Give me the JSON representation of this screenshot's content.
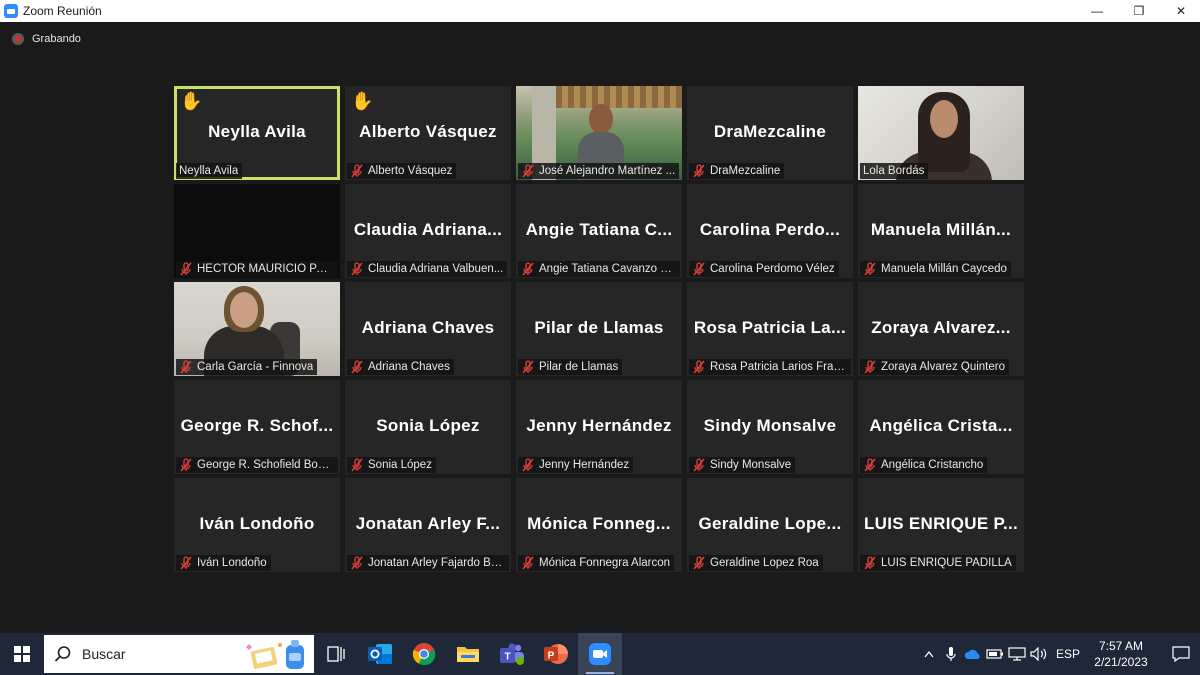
{
  "window": {
    "title": "Zoom Reunión",
    "minimize_label": "—",
    "maximize_label": "❐",
    "close_label": "✕"
  },
  "recording": {
    "label": "Grabando"
  },
  "participants": [
    {
      "display": "Neylla Avila",
      "tag": "Neylla Avila",
      "hand": true,
      "muted": false,
      "video": null,
      "active": true
    },
    {
      "display": "Alberto Vásquez",
      "tag": "Alberto Vásquez",
      "hand": true,
      "muted": true,
      "video": null
    },
    {
      "display": "",
      "tag": "José Alejandro Martínez ...",
      "hand": false,
      "muted": true,
      "video": "cafe"
    },
    {
      "display": "DraMezcaline",
      "tag": "DraMezcaline",
      "hand": false,
      "muted": true,
      "video": null
    },
    {
      "display": "",
      "tag": "Lola Bordás",
      "hand": false,
      "muted": false,
      "video": "lola"
    },
    {
      "display": "",
      "tag": "HECTOR MAURICIO PAEZ...",
      "hand": false,
      "muted": true,
      "video": "dark"
    },
    {
      "display": "Claudia Adriana...",
      "tag": "Claudia Adriana Valbuen...",
      "hand": false,
      "muted": true,
      "video": null
    },
    {
      "display": "Angie Tatiana C...",
      "tag": "Angie Tatiana Cavanzo G...",
      "hand": false,
      "muted": true,
      "video": null
    },
    {
      "display": "Carolina Perdo...",
      "tag": "Carolina Perdomo Vélez",
      "hand": false,
      "muted": true,
      "video": null
    },
    {
      "display": "Manuela Millán...",
      "tag": "Manuela Millán Caycedo",
      "hand": false,
      "muted": true,
      "video": null
    },
    {
      "display": "",
      "tag": "Carla García - Finnova",
      "hand": false,
      "muted": true,
      "video": "carla"
    },
    {
      "display": "Adriana Chaves",
      "tag": "Adriana Chaves",
      "hand": false,
      "muted": true,
      "video": null
    },
    {
      "display": "Pilar de Llamas",
      "tag": "Pilar de Llamas",
      "hand": false,
      "muted": true,
      "video": null
    },
    {
      "display": "Rosa Patricia La...",
      "tag": "Rosa Patricia Larios Francia",
      "hand": false,
      "muted": true,
      "video": null
    },
    {
      "display": "Zoraya Alvarez...",
      "tag": "Zoraya Alvarez Quintero",
      "hand": false,
      "muted": true,
      "video": null
    },
    {
      "display": "George R. Schof...",
      "tag": "George R. Schofield Bone...",
      "hand": false,
      "muted": true,
      "video": null
    },
    {
      "display": "Sonia López",
      "tag": "Sonia López",
      "hand": false,
      "muted": true,
      "video": null
    },
    {
      "display": "Jenny Hernández",
      "tag": "Jenny Hernández",
      "hand": false,
      "muted": true,
      "video": null
    },
    {
      "display": "Sindy Monsalve",
      "tag": "Sindy Monsalve",
      "hand": false,
      "muted": true,
      "video": null
    },
    {
      "display": "Angélica Crista...",
      "tag": "Angélica Cristancho",
      "hand": false,
      "muted": true,
      "video": null
    },
    {
      "display": "Iván Londoño",
      "tag": "Iván Londoño",
      "hand": false,
      "muted": true,
      "video": null
    },
    {
      "display": "Jonatan Arley F...",
      "tag": "Jonatan Arley Fajardo Bui...",
      "hand": false,
      "muted": true,
      "video": null
    },
    {
      "display": "Mónica Fonneg...",
      "tag": "Mónica Fonnegra Alarcon",
      "hand": false,
      "muted": true,
      "video": null
    },
    {
      "display": "Geraldine Lope...",
      "tag": "Geraldine Lopez Roa",
      "hand": false,
      "muted": true,
      "video": null
    },
    {
      "display": "LUIS ENRIQUE P...",
      "tag": "LUIS ENRIQUE PADILLA",
      "hand": false,
      "muted": true,
      "video": null
    }
  ],
  "taskbar": {
    "search_placeholder": "Buscar",
    "apps": [
      {
        "name": "task-view",
        "icon": "task-view-icon"
      },
      {
        "name": "outlook",
        "icon": "outlook-icon"
      },
      {
        "name": "chrome",
        "icon": "chrome-icon"
      },
      {
        "name": "file-explorer",
        "icon": "folder-icon"
      },
      {
        "name": "teams",
        "icon": "teams-icon"
      },
      {
        "name": "powerpoint",
        "icon": "powerpoint-icon"
      },
      {
        "name": "zoom",
        "icon": "zoom-icon",
        "active": true
      }
    ],
    "language": "ESP",
    "time": "7:57 AM",
    "date": "2/21/2023"
  },
  "colors": {
    "active_speaker_border": "#c7e36c",
    "hand_raised": "#f6b93b",
    "mute_icon": "#e0413a",
    "tile_bg": "#262626"
  }
}
